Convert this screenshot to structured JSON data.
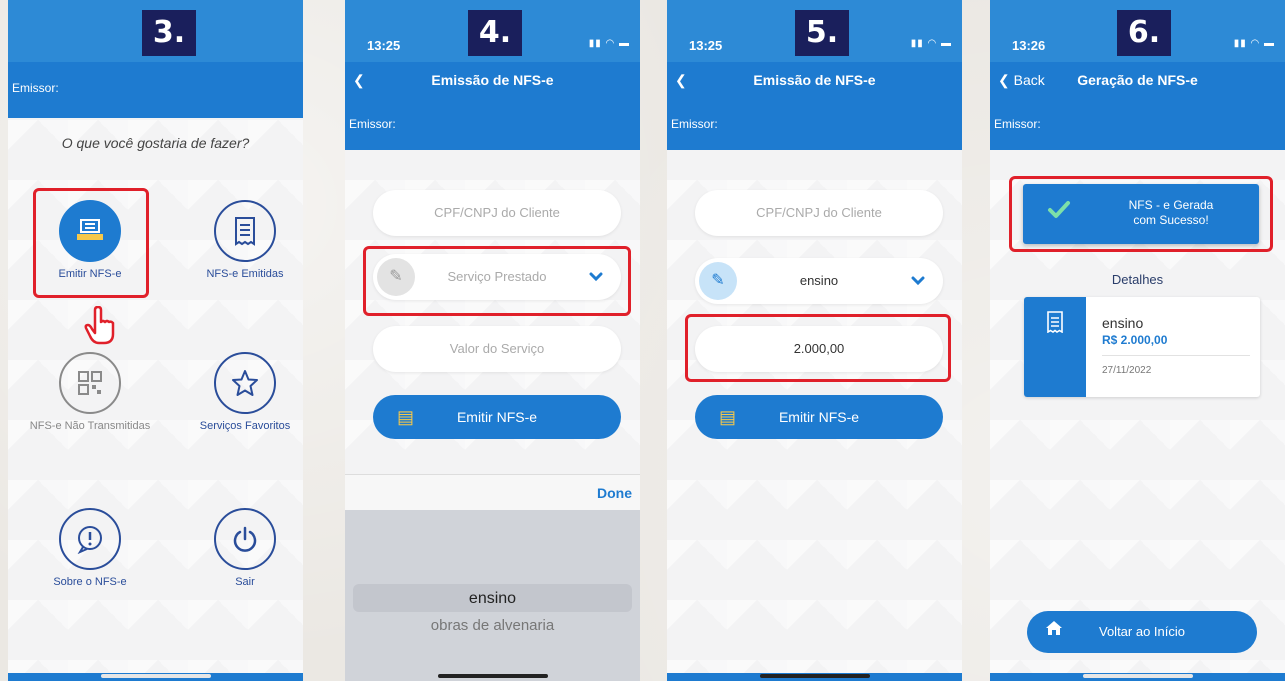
{
  "panels": {
    "p3": {
      "step": "3.",
      "emissor_label": "Emissor:",
      "question": "O que você gostaria de fazer?",
      "menu": [
        {
          "label": "Emitir NFS-e",
          "icon": "printer-receipt-icon"
        },
        {
          "label": "NFS-e Emitidas",
          "icon": "receipt-icon"
        },
        {
          "label": "NFS-e Não Transmitidas",
          "icon": "qr-code-icon"
        },
        {
          "label": "Serviços Favoritos",
          "icon": "star-icon"
        },
        {
          "label": "Sobre o NFS-e",
          "icon": "info-chat-icon"
        },
        {
          "label": "Sair",
          "icon": "power-icon"
        }
      ]
    },
    "p4": {
      "step": "4.",
      "time": "13:25",
      "title": "Emissão de NFS-e",
      "emissor_label": "Emissor:",
      "cpf_placeholder": "CPF/CNPJ do Cliente",
      "service_placeholder": "Serviço Prestado",
      "value_placeholder": "Valor do Serviço",
      "emit_label": "Emitir NFS-e",
      "done_label": "Done",
      "picker_options": [
        "ensino",
        "obras de alvenaria"
      ]
    },
    "p5": {
      "step": "5.",
      "time": "13:25",
      "title": "Emissão de NFS-e",
      "emissor_label": "Emissor:",
      "cpf_placeholder": "CPF/CNPJ do Cliente",
      "service_value": "ensino",
      "amount_value": "2.000,00",
      "emit_label": "Emitir NFS-e"
    },
    "p6": {
      "step": "6.",
      "time": "13:26",
      "back_label": "Back",
      "title": "Geração de NFS-e",
      "emissor_label": "Emissor:",
      "success_line1": "NFS - e Gerada",
      "success_line2": "com Sucesso!",
      "details_title": "Detalhes",
      "detail_name": "ensino",
      "detail_value": "R$ 2.000,00",
      "detail_date": "27/11/2022",
      "home_label": "Voltar ao Início"
    }
  },
  "colors": {
    "primary": "#1e7bd0",
    "status": "#2d8ad6",
    "highlight": "#e0202a",
    "badge": "#1a1f5c"
  }
}
